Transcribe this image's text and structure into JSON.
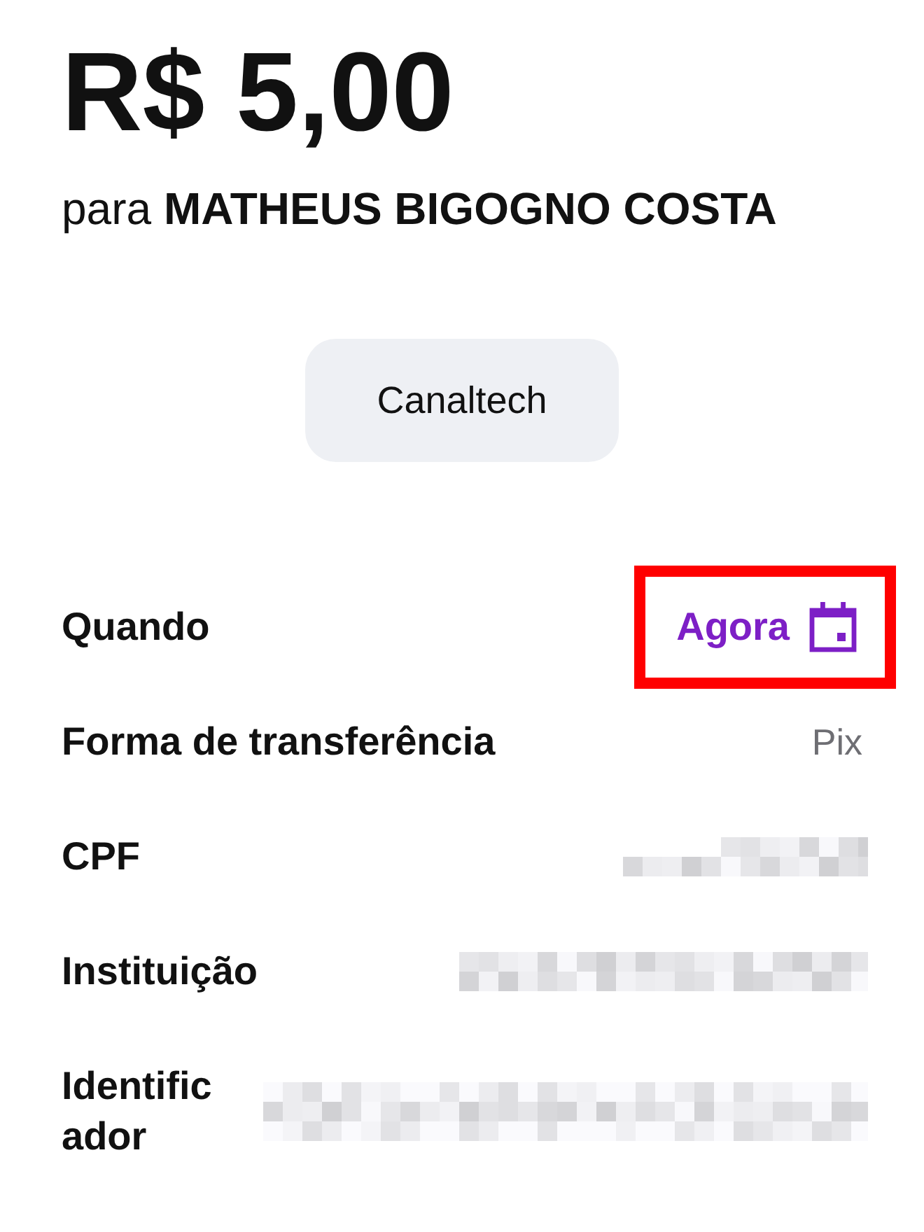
{
  "amount": "R$ 5,00",
  "recipient": "para **MATHEUS BIGOGNO COSTA**",
  "chip_button": {
    "label": "Canaltech"
  },
  "details": [
    {
      "label": "Quando",
      "kind": "action",
      "value": "Agora",
      "highlighted": true
    },
    {
      "label": "Forma de transferência",
      "kind": "text",
      "value": "Pix",
      "highlighted": false
    },
    {
      "label": "CPF",
      "kind": "redacted",
      "highlighted": false
    },
    {
      "label": "Instituição",
      "kind": "redacted",
      "highlighted": false
    },
    {
      "label": "Identificador",
      "kind": "redacted",
      "highlighted": false
    }
  ]
}
